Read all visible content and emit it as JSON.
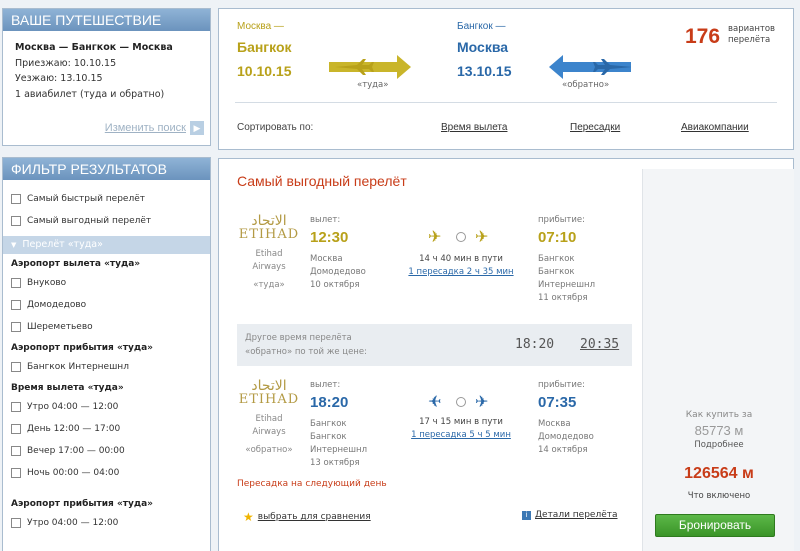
{
  "trip": {
    "title": "ВАШЕ ПУТЕШЕСТВИЕ",
    "route": "Москва — Бангкок — Москва",
    "arrive": "Приезжаю: 10.10.15",
    "leave": "Уезжаю: 13.10.15",
    "tickets": "1 авиабилет (туда и обратно)",
    "change_search": "Изменить поиск"
  },
  "filter": {
    "title": "ФИЛЬТР РЕЗУЛЬТАТОВ",
    "fastest": "Самый быстрый перелёт",
    "cheapest": "Самый выгодный перелёт",
    "sub_head": "Перелёт «туда»",
    "dep_airport_title": "Аэропорт вылета «туда»",
    "dep_airports": [
      "Внуково",
      "Домодедово",
      "Шереметьево"
    ],
    "arr_airport_title": "Аэропорт прибытия «туда»",
    "arr_airports": [
      "Бангкок Интернешнл"
    ],
    "dep_time_title": "Время вылета «туда»",
    "dep_times": [
      "Утро 04:00 — 12:00",
      "День 12:00 — 17:00",
      "Вечер 17:00 — 00:00",
      "Ночь 00:00 — 04:00"
    ],
    "arr_airport_title2": "Аэропорт прибытия «туда»",
    "arr_times": [
      "Утро 04:00 — 12:00"
    ]
  },
  "header": {
    "out_from": "Москва —",
    "out_to": "Бангкок",
    "out_date": "10.10.15",
    "out_label": "«туда»",
    "ret_from": "Бангкок —",
    "ret_to": "Москва",
    "ret_date": "13.10.15",
    "ret_label": "«обратно»",
    "count": "176",
    "count_label_1": "вариантов",
    "count_label_2": "перелёта",
    "sort_label": "Сортировать по:",
    "sort_time": "Время вылета",
    "sort_stops": "Пересадки",
    "sort_airlines": "Авиакомпании"
  },
  "result": {
    "title": "Самый выгодный перелёт",
    "outbound": {
      "airline_ar": "الاتحاد",
      "airline_logo": "ETIHAD",
      "airline_name_1": "Etihad",
      "airline_name_2": "Airways",
      "direction": "«туда»",
      "dep_label": "вылет:",
      "dep_time": "12:30",
      "dep_city": "Москва",
      "dep_airport": "Домодедово",
      "dep_date": "10 октября",
      "duration": "14 ч 40 мин в пути",
      "stops": "1 пересадка 2 ч 35 мин",
      "arr_label": "прибытие:",
      "arr_time": "07:10",
      "arr_city": "Бангкок",
      "arr_airport_1": "Бангкок",
      "arr_airport_2": "Интернешнл",
      "arr_date": "11 октября"
    },
    "alt": {
      "text_1": "Другое время перелёта",
      "text_2": "«обратно» по той же цене:",
      "time_1": "18:20",
      "time_2": "20:35"
    },
    "inbound": {
      "airline_ar": "الاتحاد",
      "airline_logo": "ETIHAD",
      "airline_name_1": "Etihad",
      "airline_name_2": "Airways",
      "direction": "«обратно»",
      "dep_label": "вылет:",
      "dep_time": "18:20",
      "dep_city": "Бангкок",
      "dep_airport_1": "Бангкок",
      "dep_airport_2": "Интернешнл",
      "dep_date": "13 октября",
      "duration": "17 ч 15 мин в пути",
      "stops": "1 пересадка 5 ч 5 мин",
      "arr_label": "прибытие:",
      "arr_time": "07:35",
      "arr_city": "Москва",
      "arr_airport": "Домодедово",
      "arr_date": "14 октября"
    },
    "next_day": "Пересадка на следующий день",
    "compare": "выбрать для сравнения",
    "details": "Детали перелёта",
    "how_to_buy": "Как купить за",
    "old_price": "85773 м",
    "more": "Подробнее",
    "price": "126564 м",
    "included": "Что включено",
    "book": "Бронировать"
  },
  "colors": {
    "gold": "#b8a11a",
    "blue": "#2a68a8",
    "accent": "#c83c18",
    "book": "#4aa838"
  }
}
